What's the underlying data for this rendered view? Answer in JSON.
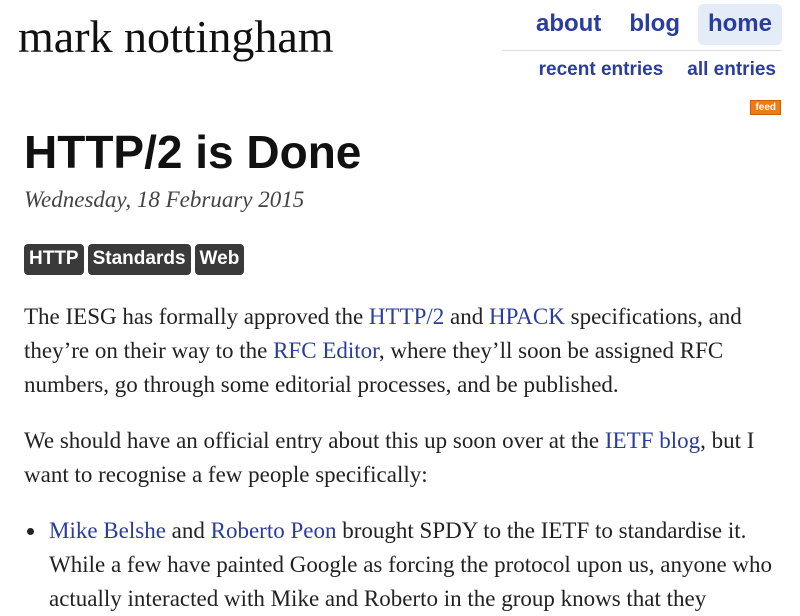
{
  "site": {
    "title": "mark nottingham"
  },
  "nav": {
    "about": "about",
    "blog": "blog",
    "home": "home",
    "recent_entries": "recent entries",
    "all_entries": "all entries",
    "feed": "feed"
  },
  "post": {
    "title": "HTTP/2 is Done",
    "date": "Wednesday, 18 February 2015",
    "tags": [
      "HTTP",
      "Standards",
      "Web"
    ],
    "p1": {
      "t1": "The IESG has formally approved the ",
      "link1": "HTTP/2",
      "t2": " and ",
      "link2": "HPACK",
      "t3": " specifications, and they’re on their way to the ",
      "link3": "RFC Editor",
      "t4": ", where they’ll soon be assigned RFC numbers, go through some editorial processes, and be published."
    },
    "p2": {
      "t1": "We should have an official entry about this up soon over at the ",
      "link1": "IETF blog",
      "t2": ", but I want to recognise a few people specifically:"
    },
    "bullet1": {
      "link1": "Mike Belshe",
      "t1": " and ",
      "link2": "Roberto Peon",
      "t2": " brought SPDY to the IETF to standardise it. While a few have painted Google as forcing the protocol upon us, anyone who actually interacted with Mike and Roberto in the group knows that they"
    }
  },
  "colors": {
    "link": "#2a3c9e",
    "active_nav_bg": "#e3ecf7",
    "tag_bg": "#3a3a3a",
    "feed_bg": "#f07b13"
  }
}
